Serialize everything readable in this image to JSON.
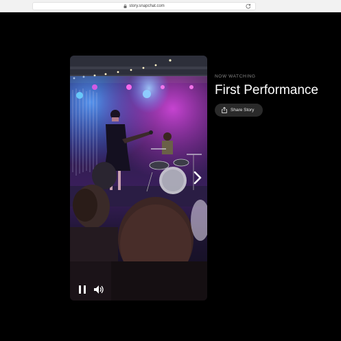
{
  "browser": {
    "url": "story.snapchat.com"
  },
  "story": {
    "controls": {
      "pause_icon": "pause-icon",
      "volume_icon": "volume-icon"
    },
    "next_icon": "chevron-right-icon"
  },
  "panel": {
    "eyebrow": "NOW WATCHING",
    "title": "First Performance",
    "share_label": "Share Story",
    "share_icon": "share-icon"
  },
  "colors": {
    "background": "#000000",
    "button_bg": "#2a2a2a",
    "title_text": "#ffffff",
    "eyebrow_text": "#8a8a8a",
    "stage_magenta": "#d13bd6",
    "stage_blue": "#3a6bff"
  }
}
